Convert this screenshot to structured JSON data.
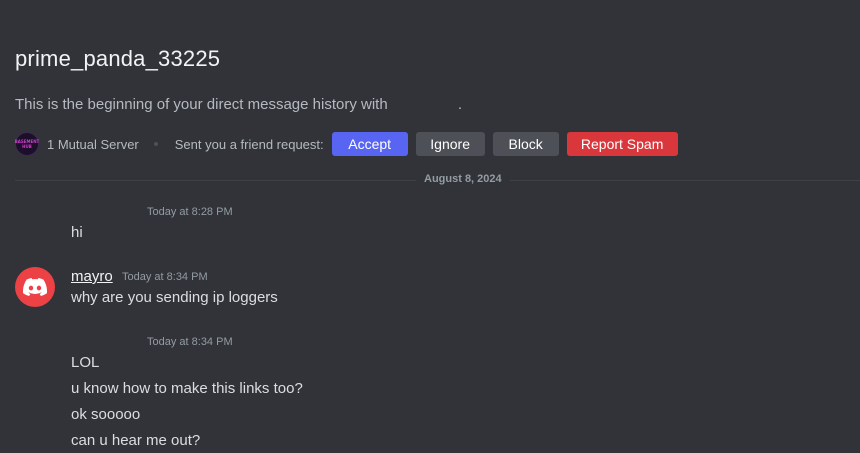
{
  "header": {
    "username": "prime_panda_33225",
    "intro_text": "This is the beginning of your direct message history with",
    "intro_end": "."
  },
  "profile_bar": {
    "server_icon_text": "BASEMENT HUB",
    "mutual_servers": "1 Mutual Server",
    "friend_request_text": "Sent you a friend request:",
    "accept_label": "Accept",
    "ignore_label": "Ignore",
    "block_label": "Block",
    "report_label": "Report Spam"
  },
  "divider": {
    "date": "August 8, 2024"
  },
  "messages": [
    {
      "timestamp": "Today at 8:28 PM",
      "lines": [
        "hi"
      ]
    },
    {
      "author": "mayro",
      "timestamp": "Today at 8:34 PM",
      "lines": [
        "why are you sending ip loggers"
      ],
      "avatar_color": "#ed4245",
      "avatar_icon": "discord-logo-icon"
    },
    {
      "timestamp": "Today at 8:34 PM",
      "lines": [
        "LOL",
        "u know how to make this links too?",
        "ok sooooo",
        "can u hear me out?"
      ]
    }
  ],
  "colors": {
    "background": "#313338",
    "accept": "#5865f2",
    "neutral_button": "#4e5058",
    "danger": "#da373c"
  }
}
